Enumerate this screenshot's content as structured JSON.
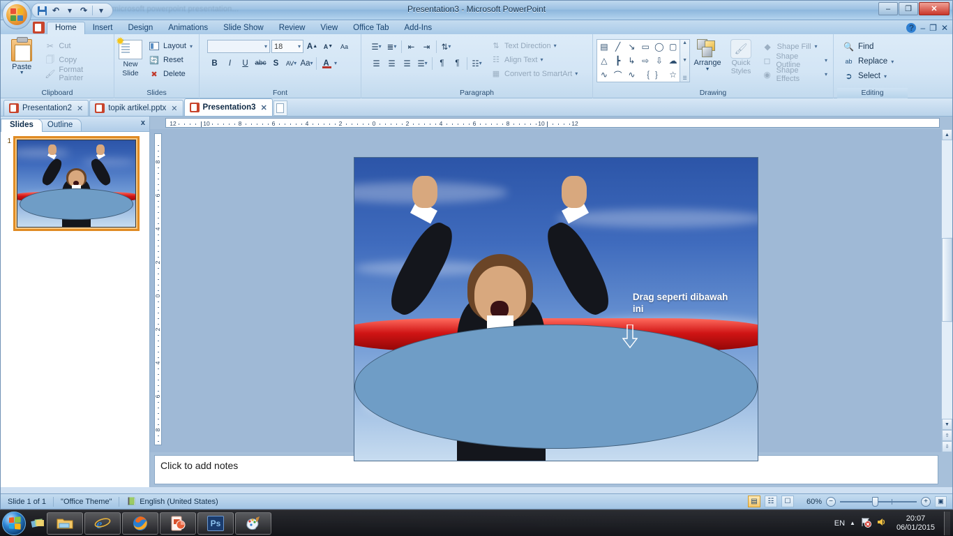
{
  "window": {
    "title": "Presentation3 - Microsoft PowerPoint",
    "ghost_left": "...microsoft powerpoint presentation...",
    "minimize": "–",
    "restore": "❐",
    "close": "✕"
  },
  "quick_access": {
    "office_button": "office-orb",
    "save": "Save",
    "undo": "Undo",
    "redo": "Redo",
    "customize": "Customize Quick Access Toolbar"
  },
  "ribbon": {
    "tabs": [
      {
        "label": "Home",
        "active": true
      },
      {
        "label": "Insert",
        "active": false
      },
      {
        "label": "Design",
        "active": false
      },
      {
        "label": "Animations",
        "active": false
      },
      {
        "label": "Slide Show",
        "active": false
      },
      {
        "label": "Review",
        "active": false
      },
      {
        "label": "View",
        "active": false
      },
      {
        "label": "Office Tab",
        "active": false
      },
      {
        "label": "Add-Ins",
        "active": false
      }
    ],
    "window_small": {
      "minimize": "–",
      "restore": "❐",
      "close": "✕",
      "help": "?"
    },
    "groups": {
      "clipboard": {
        "label": "Clipboard",
        "paste": "Paste",
        "items": [
          {
            "label": "Cut",
            "icon": "scissors-icon"
          },
          {
            "label": "Copy",
            "icon": "copy-icon"
          },
          {
            "label": "Format Painter",
            "icon": "paintbrush-icon"
          }
        ]
      },
      "slides": {
        "label": "Slides",
        "new_slide": "New\nSlide",
        "new_slide_line1": "New",
        "new_slide_line2": "Slide",
        "items": [
          {
            "label": "Layout",
            "icon": "layout-icon"
          },
          {
            "label": "Reset",
            "icon": "reset-icon"
          },
          {
            "label": "Delete",
            "icon": "delete-icon"
          }
        ]
      },
      "font": {
        "label": "Font",
        "font_name": "",
        "font_name_placeholder": "",
        "font_size": "18",
        "grow_font": "A",
        "shrink_font": "A",
        "clear_formatting": "Aa",
        "bold": "B",
        "italic": "I",
        "underline": "U",
        "strikethrough": "abc",
        "shadow": "S",
        "spacing": "AV",
        "change_case": "Aa",
        "font_color": "A"
      },
      "paragraph": {
        "label": "Paragraph",
        "text_direction": "Text Direction",
        "align_text": "Align Text",
        "convert_smartart": "Convert to SmartArt"
      },
      "drawing": {
        "label": "Drawing",
        "shapes": [
          "▤",
          "╲",
          "↘",
          "▭",
          "◯",
          "▢",
          "△",
          "┗",
          "↳",
          "⇨",
          "⇩",
          "☁",
          "⌇",
          "⌒",
          "∿",
          "｛",
          "｝",
          "☆"
        ],
        "arrange": "Arrange",
        "quick_styles_line1": "Quick",
        "quick_styles_line2": "Styles",
        "items": [
          {
            "label": "Shape Fill",
            "icon": "shape-fill-icon"
          },
          {
            "label": "Shape Outline",
            "icon": "shape-outline-icon"
          },
          {
            "label": "Shape Effects",
            "icon": "shape-effects-icon"
          }
        ]
      },
      "editing": {
        "label": "Editing",
        "items": [
          {
            "label": "Find",
            "icon": "binoculars-icon"
          },
          {
            "label": "Replace",
            "icon": "replace-icon"
          },
          {
            "label": "Select",
            "icon": "cursor-icon"
          }
        ]
      }
    }
  },
  "office_tabs": {
    "tabs": [
      {
        "label": "Presentation2",
        "active": false,
        "close": "✕"
      },
      {
        "label": "topik artikel.pptx",
        "active": false,
        "close": "✕"
      },
      {
        "label": "Presentation3",
        "active": true,
        "close": "✕"
      }
    ],
    "new_tab": "new-document"
  },
  "left_pane": {
    "tabs": [
      {
        "label": "Slides",
        "active": true
      },
      {
        "label": "Outline",
        "active": false
      }
    ],
    "close": "x",
    "slides": [
      {
        "number": "1",
        "selected": true
      }
    ]
  },
  "rulers": {
    "horizontal": [
      "12",
      "10",
      "8",
      "6",
      "4",
      "2",
      "0",
      "2",
      "4",
      "6",
      "8",
      "10",
      "12"
    ],
    "vertical": [
      "8",
      "6",
      "4",
      "2",
      "0",
      "2",
      "4",
      "6",
      "8"
    ]
  },
  "slide": {
    "annotation_text": "Drag seperti dibawah ini",
    "annotation_line1": "Drag seperti dibawah",
    "annotation_line2": "ini",
    "arrow": "down-arrow",
    "ellipse_fill": "#6f9dc6",
    "ellipse_outline": "#3f5d79"
  },
  "notes": {
    "placeholder": "Click to add notes"
  },
  "status_bar": {
    "slide_count": "Slide 1 of 1",
    "theme": "\"Office Theme\"",
    "language": "English (United States)",
    "spell_icon": "spell-check-icon",
    "views": [
      {
        "name": "normal-view",
        "glyph": "▤",
        "active": true
      },
      {
        "name": "slide-sorter-view",
        "glyph": "☷",
        "active": false
      },
      {
        "name": "slide-show-view",
        "glyph": "☐",
        "active": false
      }
    ],
    "zoom_level": "60%",
    "zoom_out": "−",
    "zoom_in": "+",
    "fit_to_window": "fit-slide-icon"
  },
  "taskbar": {
    "start": "start-orb",
    "show_desktop_peek": "aero-peek",
    "buttons": [
      {
        "name": "windows-explorer",
        "glyph": "folder-icon"
      },
      {
        "name": "internet-explorer",
        "glyph": "e-icon"
      },
      {
        "name": "mozilla-firefox",
        "glyph": "firefox-icon"
      },
      {
        "name": "microsoft-powerpoint",
        "glyph": "powerpoint-icon"
      },
      {
        "name": "adobe-photoshop",
        "glyph": "Ps"
      },
      {
        "name": "microsoft-paint",
        "glyph": "palette-icon"
      }
    ],
    "tray": {
      "language": "EN",
      "show_hidden": "▲",
      "network_flag": "action-center-icon",
      "volume": "volume-icon"
    },
    "clock_time": "20:07",
    "clock_date": "06/01/2015"
  }
}
